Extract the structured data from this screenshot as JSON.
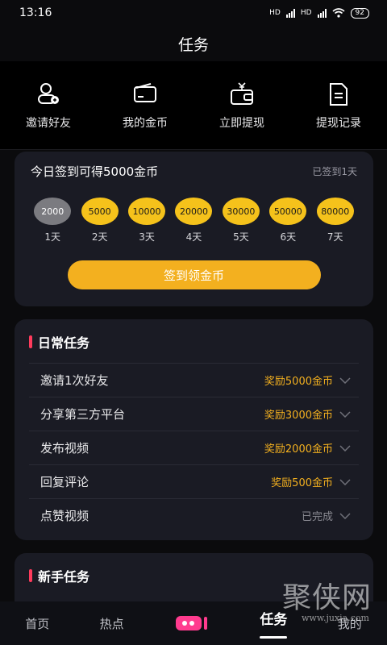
{
  "status": {
    "time": "13:16",
    "battery": "92",
    "net1": "HD",
    "net2": "HD"
  },
  "header": {
    "title": "任务"
  },
  "quick_actions": [
    {
      "label": "邀请好友",
      "icon": "invite-friend-icon"
    },
    {
      "label": "我的金币",
      "icon": "wallet-icon"
    },
    {
      "label": "立即提现",
      "icon": "withdraw-icon"
    },
    {
      "label": "提现记录",
      "icon": "record-document-icon"
    }
  ],
  "signin": {
    "title": "今日签到可得5000金币",
    "status": "已签到1天",
    "days": [
      {
        "coins": "2000",
        "label": "1天",
        "done": true
      },
      {
        "coins": "5000",
        "label": "2天",
        "done": false
      },
      {
        "coins": "10000",
        "label": "3天",
        "done": false
      },
      {
        "coins": "20000",
        "label": "4天",
        "done": false
      },
      {
        "coins": "30000",
        "label": "5天",
        "done": false
      },
      {
        "coins": "50000",
        "label": "6天",
        "done": false
      },
      {
        "coins": "80000",
        "label": "7天",
        "done": false
      }
    ],
    "button": "签到领金币"
  },
  "daily": {
    "title": "日常任务",
    "tasks": [
      {
        "name": "邀请1次好友",
        "reward": "奖励5000金币",
        "finished": false
      },
      {
        "name": "分享第三方平台",
        "reward": "奖励3000金币",
        "finished": false
      },
      {
        "name": "发布视频",
        "reward": "奖励2000金币",
        "finished": false
      },
      {
        "name": "回复评论",
        "reward": "奖励500金币",
        "finished": false
      },
      {
        "name": "点赞视频",
        "reward": "已完成",
        "finished": true
      }
    ]
  },
  "newbie": {
    "title": "新手任务"
  },
  "tabbar": {
    "home": "首页",
    "hot": "热点",
    "tasks": "任务",
    "mine": "我的"
  },
  "watermark": {
    "big": "聚侠网",
    "small": "www.juxia.com"
  },
  "colors": {
    "accent": "#f3b01f",
    "coin": "#f5c21b",
    "marker": "#ff3b5c",
    "card": "#1a1b24"
  }
}
